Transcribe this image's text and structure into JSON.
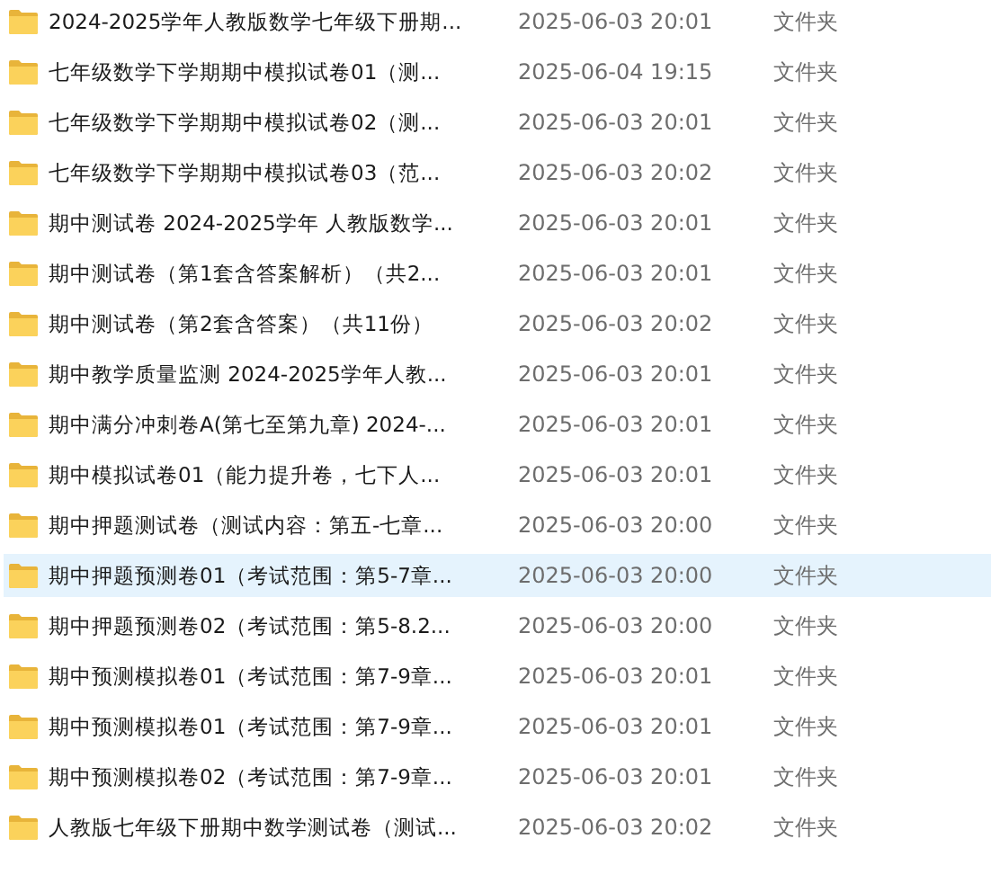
{
  "files": [
    {
      "name": "2024-2025学年人教版数学七年级下册期...",
      "modified": "2025-06-03 20:01",
      "type": "文件夹",
      "selected": false
    },
    {
      "name": "七年级数学下学期期中模拟试卷01（测...",
      "modified": "2025-06-04 19:15",
      "type": "文件夹",
      "selected": false
    },
    {
      "name": "七年级数学下学期期中模拟试卷02（测...",
      "modified": "2025-06-03 20:01",
      "type": "文件夹",
      "selected": false
    },
    {
      "name": "七年级数学下学期期中模拟试卷03（范...",
      "modified": "2025-06-03 20:02",
      "type": "文件夹",
      "selected": false
    },
    {
      "name": "期中测试卷 2024-2025学年 人教版数学...",
      "modified": "2025-06-03 20:01",
      "type": "文件夹",
      "selected": false
    },
    {
      "name": "期中测试卷（第1套含答案解析）（共2...",
      "modified": "2025-06-03 20:01",
      "type": "文件夹",
      "selected": false
    },
    {
      "name": "期中测试卷（第2套含答案）（共11份）",
      "modified": "2025-06-03 20:02",
      "type": "文件夹",
      "selected": false
    },
    {
      "name": "期中教学质量监测  2024-2025学年人教...",
      "modified": "2025-06-03 20:01",
      "type": "文件夹",
      "selected": false
    },
    {
      "name": "期中满分冲刺卷A(第七至第九章)   2024-...",
      "modified": "2025-06-03 20:01",
      "type": "文件夹",
      "selected": false
    },
    {
      "name": "期中模拟试卷01（能力提升卷，七下人...",
      "modified": "2025-06-03 20:01",
      "type": "文件夹",
      "selected": false
    },
    {
      "name": "期中押题测试卷（测试内容：第五-七章...",
      "modified": "2025-06-03 20:00",
      "type": "文件夹",
      "selected": false
    },
    {
      "name": "期中押题预测卷01（考试范围：第5-7章...",
      "modified": "2025-06-03 20:00",
      "type": "文件夹",
      "selected": true
    },
    {
      "name": "期中押题预测卷02（考试范围：第5-8.2...",
      "modified": "2025-06-03 20:00",
      "type": "文件夹",
      "selected": false
    },
    {
      "name": "期中预测模拟卷01（考试范围：第7-9章...",
      "modified": "2025-06-03 20:01",
      "type": "文件夹",
      "selected": false
    },
    {
      "name": "期中预测模拟卷01（考试范围：第7-9章...",
      "modified": "2025-06-03 20:01",
      "type": "文件夹",
      "selected": false
    },
    {
      "name": "期中预测模拟卷02（考试范围：第7-9章...",
      "modified": "2025-06-03 20:01",
      "type": "文件夹",
      "selected": false
    },
    {
      "name": "人教版七年级下册期中数学测试卷（测试...",
      "modified": "2025-06-03 20:02",
      "type": "文件夹",
      "selected": false
    }
  ]
}
